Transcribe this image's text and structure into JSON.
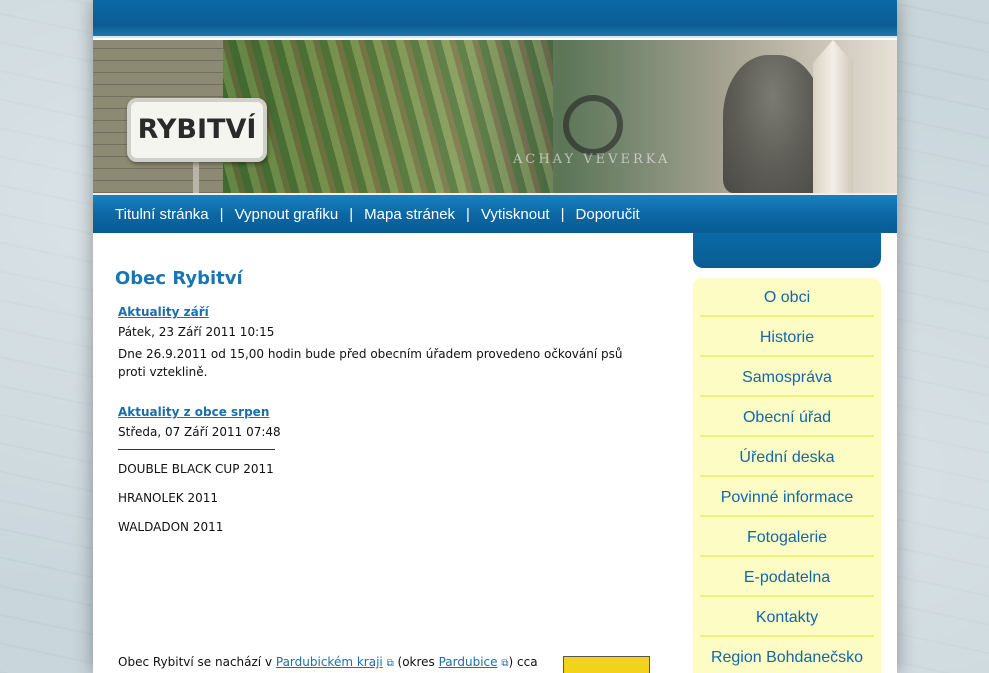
{
  "banner": {
    "sign_text": "RYBITVÍ",
    "plaque_text": "ACHAY VEVERKA"
  },
  "nav": {
    "items": [
      "Titulní stránka",
      "Vypnout grafiku",
      "Mapa stránek",
      "Vytisknout",
      "Doporučit"
    ],
    "separator": "|"
  },
  "main": {
    "title": "Obec Rybitví",
    "news": [
      {
        "title": "Aktuality září",
        "date": "Pátek, 23 Září 2011 10:15",
        "text": "Dne 26.9.2011 od 15,00 hodin bude před obecním úřadem provedeno očkování psů proti vzteklině."
      },
      {
        "title": "Aktuality z obce srpen",
        "date": "Středa, 07 Září 2011 07:48",
        "paragraphs": [
          "DOUBLE BLACK CUP 2011",
          "HRANOLEK 2011",
          "WALDADON 2011"
        ]
      }
    ],
    "intro": {
      "prefix": "Obec Rybitví se nachází v ",
      "link1": "Pardubickém kraji",
      "middle": " (okres ",
      "link2": "Pardubice",
      "suffix": ") cca"
    }
  },
  "sidebar": {
    "items": [
      "O obci",
      "Historie",
      "Samospráva",
      "Obecní úřad",
      "Úřední deska",
      "Povinné informace",
      "Fotogalerie",
      "E-podatelna",
      "Kontakty",
      "Region Bohdanečsko"
    ]
  },
  "icons": {
    "external_link": "external-link-icon"
  },
  "colors": {
    "accent": "#1976b3",
    "nav_bg": "#0b66a3",
    "sidebar_bg": "#fdfcc4"
  }
}
